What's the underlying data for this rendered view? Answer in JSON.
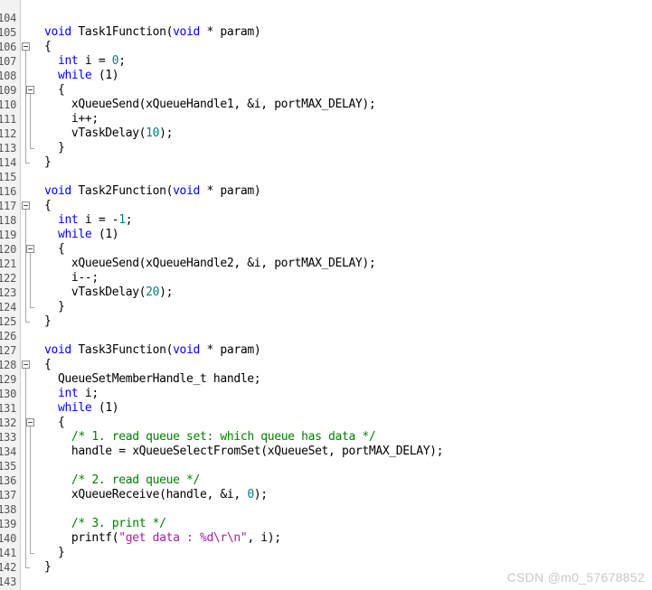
{
  "editor": {
    "language": "c",
    "first_line_number": 104,
    "last_line_number": 143,
    "colors": {
      "background": "#ffffff",
      "gutter_background": "#f2f2f2",
      "line_number": "#555555",
      "keyword": "#0000ff",
      "number": "#008080",
      "comment": "#008000",
      "string": "#a31fa3",
      "plain_text": "#000000",
      "fold_line": "#a8a8a8"
    }
  },
  "line_numbers": [
    "104",
    "105",
    "106",
    "107",
    "108",
    "109",
    "110",
    "111",
    "112",
    "113",
    "114",
    "115",
    "116",
    "117",
    "118",
    "119",
    "120",
    "121",
    "122",
    "123",
    "124",
    "125",
    "126",
    "127",
    "128",
    "129",
    "130",
    "131",
    "132",
    "133",
    "134",
    "135",
    "136",
    "137",
    "138",
    "139",
    "140",
    "141",
    "142",
    "143"
  ],
  "code_lines": [
    {
      "number": "104",
      "indent": 0,
      "tokens": []
    },
    {
      "number": "105",
      "indent": 0,
      "tokens": [
        {
          "t": "void",
          "c": "kw"
        },
        {
          "t": " Task1Function(",
          "c": "pln"
        },
        {
          "t": "void",
          "c": "kw"
        },
        {
          "t": " * param)",
          "c": "pln"
        }
      ]
    },
    {
      "number": "106",
      "indent": 0,
      "tokens": [
        {
          "t": "{",
          "c": "pln"
        }
      ]
    },
    {
      "number": "107",
      "indent": 0,
      "tokens": [
        {
          "t": "  ",
          "c": "pln"
        },
        {
          "t": "int",
          "c": "kw"
        },
        {
          "t": " i = ",
          "c": "pln"
        },
        {
          "t": "0",
          "c": "num"
        },
        {
          "t": ";",
          "c": "pln"
        }
      ]
    },
    {
      "number": "108",
      "indent": 0,
      "tokens": [
        {
          "t": "  ",
          "c": "pln"
        },
        {
          "t": "while",
          "c": "kw"
        },
        {
          "t": " (1)",
          "c": "pln"
        }
      ]
    },
    {
      "number": "109",
      "indent": 0,
      "tokens": [
        {
          "t": "  {",
          "c": "pln"
        }
      ]
    },
    {
      "number": "110",
      "indent": 0,
      "tokens": [
        {
          "t": "    xQueueSend(xQueueHandle1, &i, portMAX_DELAY);",
          "c": "pln"
        }
      ]
    },
    {
      "number": "111",
      "indent": 0,
      "tokens": [
        {
          "t": "    i++;",
          "c": "pln"
        }
      ]
    },
    {
      "number": "112",
      "indent": 0,
      "tokens": [
        {
          "t": "    vTaskDelay(",
          "c": "pln"
        },
        {
          "t": "10",
          "c": "num"
        },
        {
          "t": ");",
          "c": "pln"
        }
      ]
    },
    {
      "number": "113",
      "indent": 0,
      "tokens": [
        {
          "t": "  }",
          "c": "pln"
        }
      ]
    },
    {
      "number": "114",
      "indent": 0,
      "tokens": [
        {
          "t": "}",
          "c": "pln"
        }
      ]
    },
    {
      "number": "115",
      "indent": 0,
      "tokens": []
    },
    {
      "number": "116",
      "indent": 0,
      "tokens": [
        {
          "t": "void",
          "c": "kw"
        },
        {
          "t": " Task2Function(",
          "c": "pln"
        },
        {
          "t": "void",
          "c": "kw"
        },
        {
          "t": " * param)",
          "c": "pln"
        }
      ]
    },
    {
      "number": "117",
      "indent": 0,
      "tokens": [
        {
          "t": "{",
          "c": "pln"
        }
      ]
    },
    {
      "number": "118",
      "indent": 0,
      "tokens": [
        {
          "t": "  ",
          "c": "pln"
        },
        {
          "t": "int",
          "c": "kw"
        },
        {
          "t": " i = -",
          "c": "pln"
        },
        {
          "t": "1",
          "c": "num"
        },
        {
          "t": ";",
          "c": "pln"
        }
      ]
    },
    {
      "number": "119",
      "indent": 0,
      "tokens": [
        {
          "t": "  ",
          "c": "pln"
        },
        {
          "t": "while",
          "c": "kw"
        },
        {
          "t": " (1)",
          "c": "pln"
        }
      ]
    },
    {
      "number": "120",
      "indent": 0,
      "tokens": [
        {
          "t": "  {",
          "c": "pln"
        }
      ]
    },
    {
      "number": "121",
      "indent": 0,
      "tokens": [
        {
          "t": "    xQueueSend(xQueueHandle2, &i, portMAX_DELAY);",
          "c": "pln"
        }
      ]
    },
    {
      "number": "122",
      "indent": 0,
      "tokens": [
        {
          "t": "    i--;",
          "c": "pln"
        }
      ]
    },
    {
      "number": "123",
      "indent": 0,
      "tokens": [
        {
          "t": "    vTaskDelay(",
          "c": "pln"
        },
        {
          "t": "20",
          "c": "num"
        },
        {
          "t": ");",
          "c": "pln"
        }
      ]
    },
    {
      "number": "124",
      "indent": 0,
      "tokens": [
        {
          "t": "  }",
          "c": "pln"
        }
      ]
    },
    {
      "number": "125",
      "indent": 0,
      "tokens": [
        {
          "t": "}",
          "c": "pln"
        }
      ]
    },
    {
      "number": "126",
      "indent": 0,
      "tokens": []
    },
    {
      "number": "127",
      "indent": 0,
      "tokens": [
        {
          "t": "void",
          "c": "kw"
        },
        {
          "t": " Task3Function(",
          "c": "pln"
        },
        {
          "t": "void",
          "c": "kw"
        },
        {
          "t": " * param)",
          "c": "pln"
        }
      ]
    },
    {
      "number": "128",
      "indent": 0,
      "tokens": [
        {
          "t": "{",
          "c": "pln"
        }
      ]
    },
    {
      "number": "129",
      "indent": 0,
      "tokens": [
        {
          "t": "  QueueSetMemberHandle_t handle;",
          "c": "pln"
        }
      ]
    },
    {
      "number": "130",
      "indent": 0,
      "tokens": [
        {
          "t": "  ",
          "c": "pln"
        },
        {
          "t": "int",
          "c": "kw"
        },
        {
          "t": " i;",
          "c": "pln"
        }
      ]
    },
    {
      "number": "131",
      "indent": 0,
      "tokens": [
        {
          "t": "  ",
          "c": "pln"
        },
        {
          "t": "while",
          "c": "kw"
        },
        {
          "t": " (1)",
          "c": "pln"
        }
      ]
    },
    {
      "number": "132",
      "indent": 0,
      "tokens": [
        {
          "t": "  {",
          "c": "pln"
        }
      ]
    },
    {
      "number": "133",
      "indent": 0,
      "tokens": [
        {
          "t": "    ",
          "c": "pln"
        },
        {
          "t": "/* 1. read queue set: which queue has data */",
          "c": "cmt"
        }
      ]
    },
    {
      "number": "134",
      "indent": 0,
      "tokens": [
        {
          "t": "    handle = xQueueSelectFromSet(xQueueSet, portMAX_DELAY);",
          "c": "pln"
        }
      ]
    },
    {
      "number": "135",
      "indent": 0,
      "tokens": []
    },
    {
      "number": "136",
      "indent": 0,
      "tokens": [
        {
          "t": "    ",
          "c": "pln"
        },
        {
          "t": "/* 2. read queue */",
          "c": "cmt"
        }
      ]
    },
    {
      "number": "137",
      "indent": 0,
      "tokens": [
        {
          "t": "    xQueueReceive(handle, &i, ",
          "c": "pln"
        },
        {
          "t": "0",
          "c": "num"
        },
        {
          "t": ");",
          "c": "pln"
        }
      ]
    },
    {
      "number": "138",
      "indent": 0,
      "tokens": []
    },
    {
      "number": "139",
      "indent": 0,
      "tokens": [
        {
          "t": "    ",
          "c": "pln"
        },
        {
          "t": "/* 3. print */",
          "c": "cmt"
        }
      ]
    },
    {
      "number": "140",
      "indent": 0,
      "tokens": [
        {
          "t": "    printf(",
          "c": "pln"
        },
        {
          "t": "\"get data : %d\\r\\n\"",
          "c": "str"
        },
        {
          "t": ", i);",
          "c": "pln"
        }
      ]
    },
    {
      "number": "141",
      "indent": 0,
      "tokens": [
        {
          "t": "  }",
          "c": "pln"
        }
      ]
    },
    {
      "number": "142",
      "indent": 0,
      "tokens": [
        {
          "t": "}",
          "c": "pln"
        }
      ]
    },
    {
      "number": "143",
      "indent": 0,
      "tokens": []
    }
  ],
  "fold_markers": [
    {
      "name": "fold-toggle-task1-body",
      "line_index": 2,
      "expanded": true
    },
    {
      "name": "fold-toggle-task1-while",
      "line_index": 5,
      "expanded": true
    },
    {
      "name": "fold-toggle-task2-body",
      "line_index": 13,
      "expanded": true
    },
    {
      "name": "fold-toggle-task2-while",
      "line_index": 16,
      "expanded": true
    },
    {
      "name": "fold-toggle-task3-body",
      "line_index": 24,
      "expanded": true
    },
    {
      "name": "fold-toggle-task3-while",
      "line_index": 28,
      "expanded": true
    }
  ],
  "fold_regions": [
    {
      "start_index": 2,
      "end_index": 10
    },
    {
      "start_index": 5,
      "end_index": 9
    },
    {
      "start_index": 13,
      "end_index": 21
    },
    {
      "start_index": 16,
      "end_index": 20
    },
    {
      "start_index": 24,
      "end_index": 38
    },
    {
      "start_index": 28,
      "end_index": 37
    }
  ],
  "watermark": {
    "text": "CSDN @m0_57678852"
  }
}
